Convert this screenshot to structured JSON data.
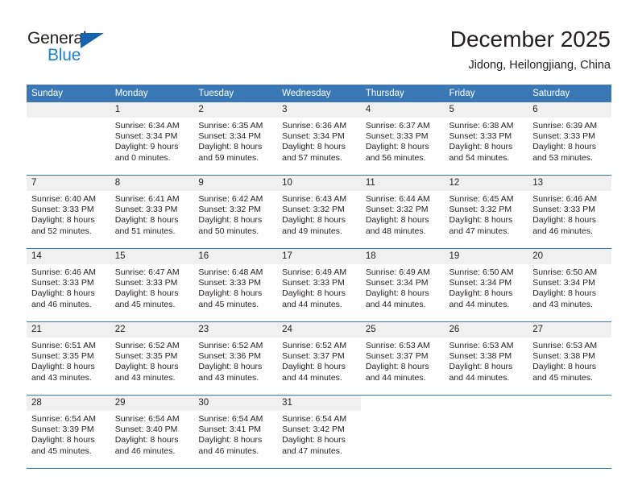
{
  "logo": {
    "word_top": "General",
    "word_bottom": "Blue",
    "triangle_color": "#1664ac",
    "blue_color": "#1d7fd4"
  },
  "header": {
    "title": "December 2025",
    "location": "Jidong, Heilongjiang, China"
  },
  "theme": {
    "header_bg": "#3a77b5",
    "daynum_bg": "#f0f0f0",
    "row_divider": "#3a77b5",
    "text": "#231f20"
  },
  "weekday_headers": [
    "Sunday",
    "Monday",
    "Tuesday",
    "Wednesday",
    "Thursday",
    "Friday",
    "Saturday"
  ],
  "weeks": [
    [
      {
        "day": "",
        "empty": true,
        "sunrise": "",
        "sunset": "",
        "daylight1": "",
        "daylight2": ""
      },
      {
        "day": "1",
        "sunrise": "Sunrise: 6:34 AM",
        "sunset": "Sunset: 3:34 PM",
        "daylight1": "Daylight: 9 hours",
        "daylight2": "and 0 minutes."
      },
      {
        "day": "2",
        "sunrise": "Sunrise: 6:35 AM",
        "sunset": "Sunset: 3:34 PM",
        "daylight1": "Daylight: 8 hours",
        "daylight2": "and 59 minutes."
      },
      {
        "day": "3",
        "sunrise": "Sunrise: 6:36 AM",
        "sunset": "Sunset: 3:34 PM",
        "daylight1": "Daylight: 8 hours",
        "daylight2": "and 57 minutes."
      },
      {
        "day": "4",
        "sunrise": "Sunrise: 6:37 AM",
        "sunset": "Sunset: 3:33 PM",
        "daylight1": "Daylight: 8 hours",
        "daylight2": "and 56 minutes."
      },
      {
        "day": "5",
        "sunrise": "Sunrise: 6:38 AM",
        "sunset": "Sunset: 3:33 PM",
        "daylight1": "Daylight: 8 hours",
        "daylight2": "and 54 minutes."
      },
      {
        "day": "6",
        "sunrise": "Sunrise: 6:39 AM",
        "sunset": "Sunset: 3:33 PM",
        "daylight1": "Daylight: 8 hours",
        "daylight2": "and 53 minutes."
      }
    ],
    [
      {
        "day": "7",
        "sunrise": "Sunrise: 6:40 AM",
        "sunset": "Sunset: 3:33 PM",
        "daylight1": "Daylight: 8 hours",
        "daylight2": "and 52 minutes."
      },
      {
        "day": "8",
        "sunrise": "Sunrise: 6:41 AM",
        "sunset": "Sunset: 3:33 PM",
        "daylight1": "Daylight: 8 hours",
        "daylight2": "and 51 minutes."
      },
      {
        "day": "9",
        "sunrise": "Sunrise: 6:42 AM",
        "sunset": "Sunset: 3:32 PM",
        "daylight1": "Daylight: 8 hours",
        "daylight2": "and 50 minutes."
      },
      {
        "day": "10",
        "sunrise": "Sunrise: 6:43 AM",
        "sunset": "Sunset: 3:32 PM",
        "daylight1": "Daylight: 8 hours",
        "daylight2": "and 49 minutes."
      },
      {
        "day": "11",
        "sunrise": "Sunrise: 6:44 AM",
        "sunset": "Sunset: 3:32 PM",
        "daylight1": "Daylight: 8 hours",
        "daylight2": "and 48 minutes."
      },
      {
        "day": "12",
        "sunrise": "Sunrise: 6:45 AM",
        "sunset": "Sunset: 3:32 PM",
        "daylight1": "Daylight: 8 hours",
        "daylight2": "and 47 minutes."
      },
      {
        "day": "13",
        "sunrise": "Sunrise: 6:46 AM",
        "sunset": "Sunset: 3:33 PM",
        "daylight1": "Daylight: 8 hours",
        "daylight2": "and 46 minutes."
      }
    ],
    [
      {
        "day": "14",
        "sunrise": "Sunrise: 6:46 AM",
        "sunset": "Sunset: 3:33 PM",
        "daylight1": "Daylight: 8 hours",
        "daylight2": "and 46 minutes."
      },
      {
        "day": "15",
        "sunrise": "Sunrise: 6:47 AM",
        "sunset": "Sunset: 3:33 PM",
        "daylight1": "Daylight: 8 hours",
        "daylight2": "and 45 minutes."
      },
      {
        "day": "16",
        "sunrise": "Sunrise: 6:48 AM",
        "sunset": "Sunset: 3:33 PM",
        "daylight1": "Daylight: 8 hours",
        "daylight2": "and 45 minutes."
      },
      {
        "day": "17",
        "sunrise": "Sunrise: 6:49 AM",
        "sunset": "Sunset: 3:33 PM",
        "daylight1": "Daylight: 8 hours",
        "daylight2": "and 44 minutes."
      },
      {
        "day": "18",
        "sunrise": "Sunrise: 6:49 AM",
        "sunset": "Sunset: 3:34 PM",
        "daylight1": "Daylight: 8 hours",
        "daylight2": "and 44 minutes."
      },
      {
        "day": "19",
        "sunrise": "Sunrise: 6:50 AM",
        "sunset": "Sunset: 3:34 PM",
        "daylight1": "Daylight: 8 hours",
        "daylight2": "and 44 minutes."
      },
      {
        "day": "20",
        "sunrise": "Sunrise: 6:50 AM",
        "sunset": "Sunset: 3:34 PM",
        "daylight1": "Daylight: 8 hours",
        "daylight2": "and 43 minutes."
      }
    ],
    [
      {
        "day": "21",
        "sunrise": "Sunrise: 6:51 AM",
        "sunset": "Sunset: 3:35 PM",
        "daylight1": "Daylight: 8 hours",
        "daylight2": "and 43 minutes."
      },
      {
        "day": "22",
        "sunrise": "Sunrise: 6:52 AM",
        "sunset": "Sunset: 3:35 PM",
        "daylight1": "Daylight: 8 hours",
        "daylight2": "and 43 minutes."
      },
      {
        "day": "23",
        "sunrise": "Sunrise: 6:52 AM",
        "sunset": "Sunset: 3:36 PM",
        "daylight1": "Daylight: 8 hours",
        "daylight2": "and 43 minutes."
      },
      {
        "day": "24",
        "sunrise": "Sunrise: 6:52 AM",
        "sunset": "Sunset: 3:37 PM",
        "daylight1": "Daylight: 8 hours",
        "daylight2": "and 44 minutes."
      },
      {
        "day": "25",
        "sunrise": "Sunrise: 6:53 AM",
        "sunset": "Sunset: 3:37 PM",
        "daylight1": "Daylight: 8 hours",
        "daylight2": "and 44 minutes."
      },
      {
        "day": "26",
        "sunrise": "Sunrise: 6:53 AM",
        "sunset": "Sunset: 3:38 PM",
        "daylight1": "Daylight: 8 hours",
        "daylight2": "and 44 minutes."
      },
      {
        "day": "27",
        "sunrise": "Sunrise: 6:53 AM",
        "sunset": "Sunset: 3:38 PM",
        "daylight1": "Daylight: 8 hours",
        "daylight2": "and 45 minutes."
      }
    ],
    [
      {
        "day": "28",
        "sunrise": "Sunrise: 6:54 AM",
        "sunset": "Sunset: 3:39 PM",
        "daylight1": "Daylight: 8 hours",
        "daylight2": "and 45 minutes."
      },
      {
        "day": "29",
        "sunrise": "Sunrise: 6:54 AM",
        "sunset": "Sunset: 3:40 PM",
        "daylight1": "Daylight: 8 hours",
        "daylight2": "and 46 minutes."
      },
      {
        "day": "30",
        "sunrise": "Sunrise: 6:54 AM",
        "sunset": "Sunset: 3:41 PM",
        "daylight1": "Daylight: 8 hours",
        "daylight2": "and 46 minutes."
      },
      {
        "day": "31",
        "sunrise": "Sunrise: 6:54 AM",
        "sunset": "Sunset: 3:42 PM",
        "daylight1": "Daylight: 8 hours",
        "daylight2": "and 47 minutes."
      },
      {
        "day": "",
        "blank": true,
        "sunrise": "",
        "sunset": "",
        "daylight1": "",
        "daylight2": ""
      },
      {
        "day": "",
        "blank": true,
        "sunrise": "",
        "sunset": "",
        "daylight1": "",
        "daylight2": ""
      },
      {
        "day": "",
        "blank": true,
        "sunrise": "",
        "sunset": "",
        "daylight1": "",
        "daylight2": ""
      }
    ]
  ]
}
